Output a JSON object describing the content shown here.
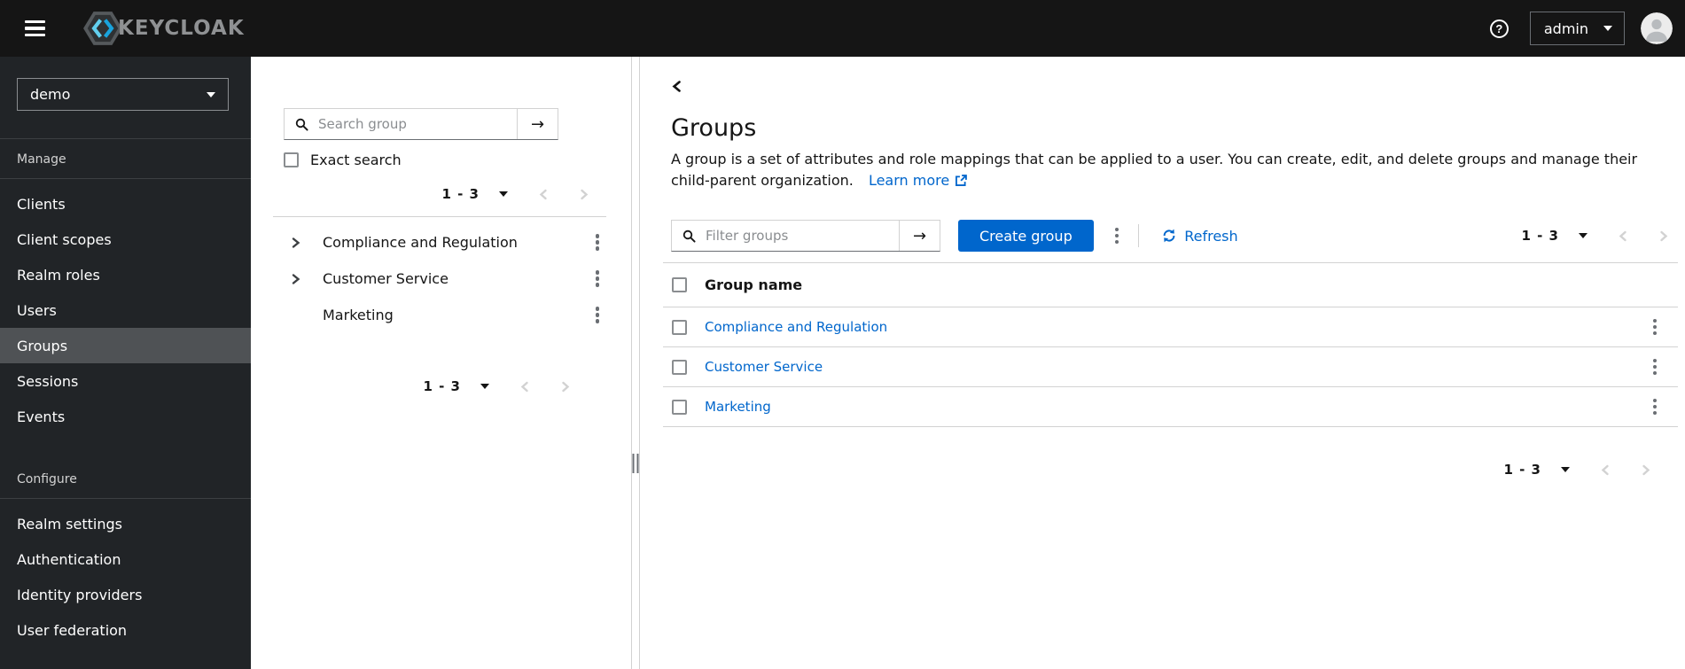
{
  "masthead": {
    "brand": "KEYCLOAK",
    "user": "admin",
    "help_glyph": "?"
  },
  "sidebar": {
    "realm": "demo",
    "selected_item": "Groups",
    "sections": [
      {
        "label": "Manage",
        "items": [
          "Clients",
          "Client scopes",
          "Realm roles",
          "Users",
          "Groups",
          "Sessions",
          "Events"
        ]
      },
      {
        "label": "Configure",
        "items": [
          "Realm settings",
          "Authentication",
          "Identity providers",
          "User federation"
        ]
      }
    ]
  },
  "tree_panel": {
    "search_placeholder": "Search group",
    "exact_search_label": "Exact search",
    "pagination_top": {
      "range": "1 - 3"
    },
    "pagination_bottom": {
      "range": "1 - 3"
    },
    "groups": [
      {
        "name": "Compliance and Regulation",
        "expandable": true
      },
      {
        "name": "Customer Service",
        "expandable": true
      },
      {
        "name": "Marketing",
        "expandable": false
      }
    ]
  },
  "main": {
    "title": "Groups",
    "description": "A group is a set of attributes and role mappings that can be applied to a user. You can create, edit, and delete groups and manage their child-parent organization.",
    "learn_more_label": "Learn more",
    "toolbar": {
      "filter_placeholder": "Filter groups",
      "create_button_label": "Create group",
      "refresh_label": "Refresh",
      "pagination": {
        "range": "1 - 3"
      }
    },
    "table": {
      "column_header": "Group name",
      "rows": [
        {
          "name": "Compliance and Regulation"
        },
        {
          "name": "Customer Service"
        },
        {
          "name": "Marketing"
        }
      ]
    },
    "pagination_bottom": {
      "range": "1 - 3"
    }
  },
  "icons": {
    "arrow_right": "→"
  },
  "colors": {
    "masthead_bg": "#151515",
    "sidebar_bg": "#212427",
    "sidebar_selected_bg": "#4f5255",
    "primary": "#0066cc",
    "link": "#0066cc",
    "border_light": "#d2d2d2"
  }
}
